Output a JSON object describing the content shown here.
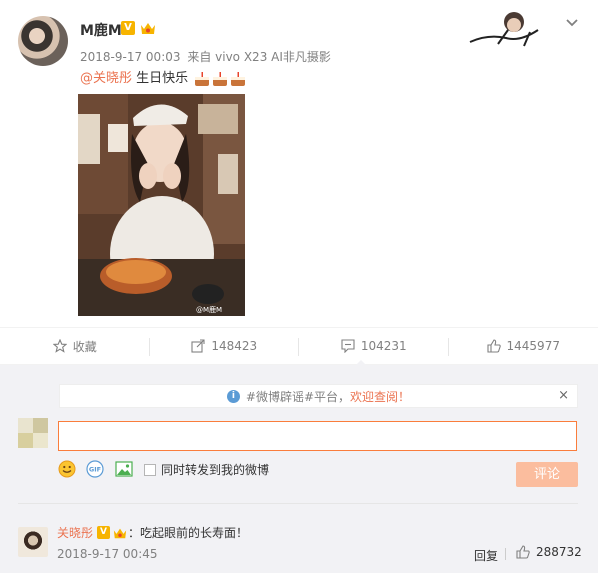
{
  "post": {
    "username": "M鹿M",
    "verified_badge": "V",
    "timestamp": "2018-9-17 00:03",
    "source": "来自 vivo X23 AI非凡摄影",
    "mention": "@关晓彤",
    "text": "生日快乐",
    "photo_watermark": "@M鹿M"
  },
  "actions": {
    "favorite_label": "收藏",
    "repost_count": "148423",
    "comment_count": "104231",
    "like_count": "1445977"
  },
  "composer": {
    "notice_prefix": "#微博辟谣#平台，",
    "notice_link": "欢迎查阅！",
    "close_glyph": "×",
    "input_value": "",
    "input_placeholder": "",
    "repost_label": "同时转发到我的微博",
    "submit_label": "评论"
  },
  "comment": {
    "author": "关晓彤",
    "verified_badge": "V",
    "text": "：吃起眼前的长寿面！",
    "timestamp": "2018-9-17 00:45",
    "reply_label": "回复",
    "like_count": "288732"
  },
  "icons": {
    "favorite": "star-icon",
    "repost": "share-icon",
    "comment": "comment-icon",
    "like": "thumbs-up-icon",
    "expand": "chevron-down-icon",
    "info": "info-icon",
    "emoji": "smiley-icon",
    "gif": "gif-icon",
    "image": "image-icon"
  },
  "colors": {
    "accent": "#eb7350",
    "verified": "#f7b400",
    "submit_disabled": "#fbbd9e",
    "input_border": "#fa7d3c",
    "panel_bg": "#f2f2f5"
  }
}
